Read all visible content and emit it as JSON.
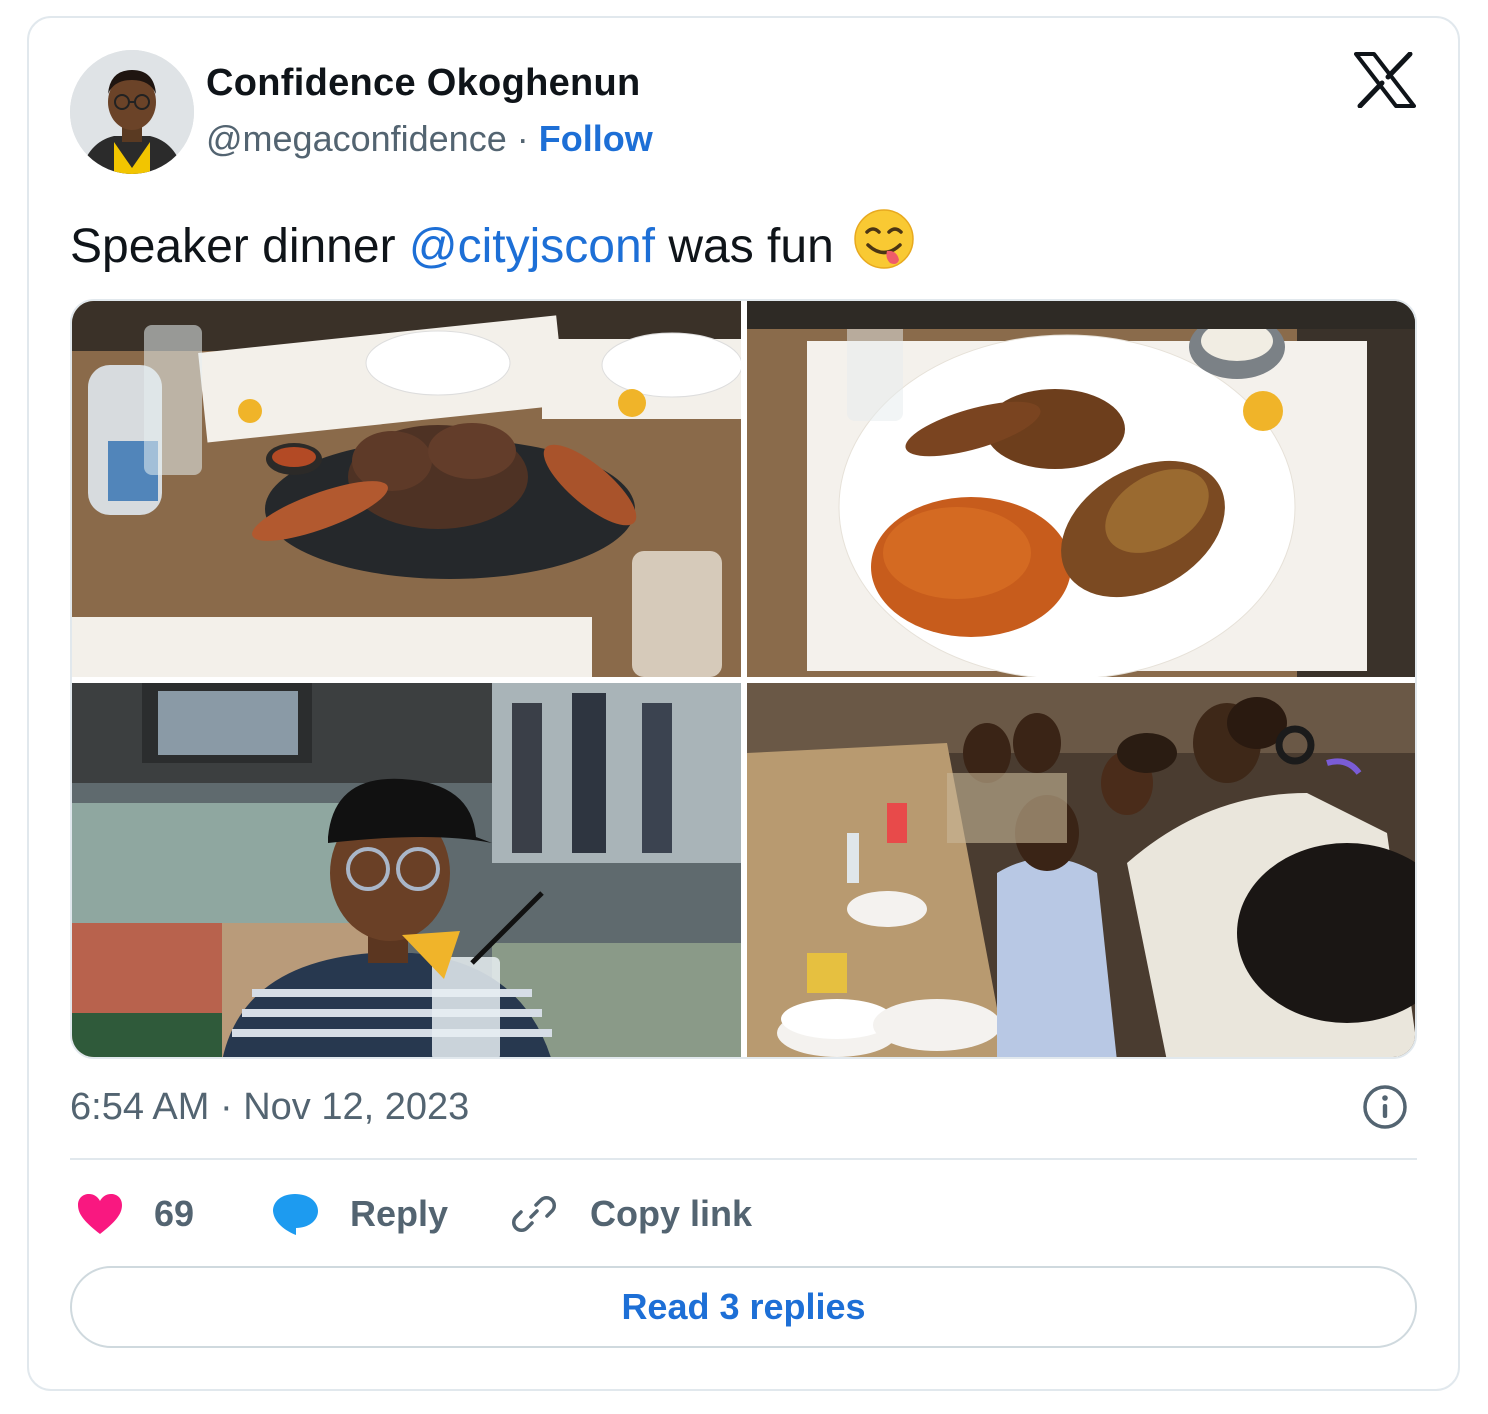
{
  "author": {
    "name": "Confidence Okoghenun",
    "handle": "@megaconfidence",
    "separator": "·",
    "follow_label": "Follow"
  },
  "platform_icon": "x-logo-icon",
  "tweet": {
    "text_before": "Speaker dinner ",
    "mention": "@cityjsconf",
    "text_after": " was fun",
    "emoji": "face-savoring-food-emoji"
  },
  "media": [
    {
      "name": "photo-grilled-meat-platter"
    },
    {
      "name": "photo-jollof-rice-chicken"
    },
    {
      "name": "photo-person-with-drink"
    },
    {
      "name": "photo-group-dinner-table"
    }
  ],
  "timestamp": "6:54 AM · Nov 12, 2023",
  "actions": {
    "like_count": "69",
    "reply_label": "Reply",
    "copy_label": "Copy link"
  },
  "read_replies_label": "Read 3 replies",
  "colors": {
    "link": "#1d6fd6",
    "heart": "#f91880",
    "reply_bubble": "#1d9bf0",
    "secondary_text": "#536471",
    "border": "#e1e8ed"
  }
}
